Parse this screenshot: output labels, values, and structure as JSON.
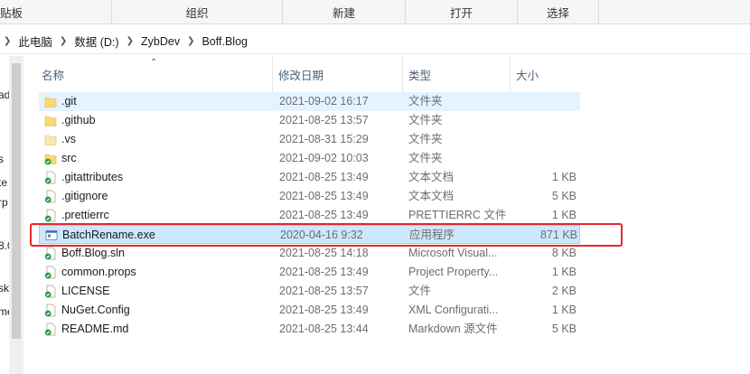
{
  "ribbon": {
    "groups": [
      "贴板",
      "组织",
      "新建",
      "打开",
      "选择"
    ]
  },
  "address": {
    "crumbs": [
      "此电脑",
      "数据 (D:)",
      "ZybDev",
      "Boff.Blog"
    ]
  },
  "nav": {
    "fragments": [
      "ad",
      "s",
      "te",
      "rp",
      "8.0",
      "sk",
      "me"
    ]
  },
  "columns": {
    "name": "名称",
    "date": "修改日期",
    "type": "类型",
    "size": "大小"
  },
  "files": [
    {
      "name": ".git",
      "date": "2021-09-02 16:17",
      "type": "文件夹",
      "size": "",
      "icon": "folder-icon"
    },
    {
      "name": ".github",
      "date": "2021-08-25 13:57",
      "type": "文件夹",
      "size": "",
      "icon": "folder-icon"
    },
    {
      "name": ".vs",
      "date": "2021-08-31 15:29",
      "type": "文件夹",
      "size": "",
      "icon": "folder-light-icon"
    },
    {
      "name": "src",
      "date": "2021-09-02 10:03",
      "type": "文件夹",
      "size": "",
      "icon": "folder-check-icon"
    },
    {
      "name": ".gitattributes",
      "date": "2021-08-25 13:49",
      "type": "文本文档",
      "size": "1 KB",
      "icon": "file-check-icon"
    },
    {
      "name": ".gitignore",
      "date": "2021-08-25 13:49",
      "type": "文本文档",
      "size": "5 KB",
      "icon": "file-check-icon"
    },
    {
      "name": ".prettierrc",
      "date": "2021-08-25 13:49",
      "type": "PRETTIERRC 文件",
      "size": "1 KB",
      "icon": "file-check-icon"
    },
    {
      "name": "BatchRename.exe",
      "date": "2020-04-16 9:32",
      "type": "应用程序",
      "size": "871 KB",
      "icon": "exe-icon"
    },
    {
      "name": "Boff.Blog.sln",
      "date": "2021-08-25 14:18",
      "type": "Microsoft Visual...",
      "size": "8 KB",
      "icon": "file-check-icon"
    },
    {
      "name": "common.props",
      "date": "2021-08-25 13:49",
      "type": "Project Property...",
      "size": "1 KB",
      "icon": "file-check-icon"
    },
    {
      "name": "LICENSE",
      "date": "2021-08-25 13:57",
      "type": "文件",
      "size": "2 KB",
      "icon": "file-check-icon"
    },
    {
      "name": "NuGet.Config",
      "date": "2021-08-25 13:49",
      "type": "XML Configurati...",
      "size": "1 KB",
      "icon": "file-check-icon"
    },
    {
      "name": "README.md",
      "date": "2021-08-25 13:44",
      "type": "Markdown 源文件",
      "size": "5 KB",
      "icon": "file-check-icon"
    }
  ],
  "state": {
    "hover_index": 0,
    "selected_index": 7
  },
  "colors": {
    "folder": "#f8d775",
    "folder_dark": "#e0b84a",
    "check": "#2a9a3d",
    "selection": "#cce8ff",
    "hover": "#e5f3ff",
    "highlight_box": "#e8262a",
    "header_text": "#4c607a"
  }
}
